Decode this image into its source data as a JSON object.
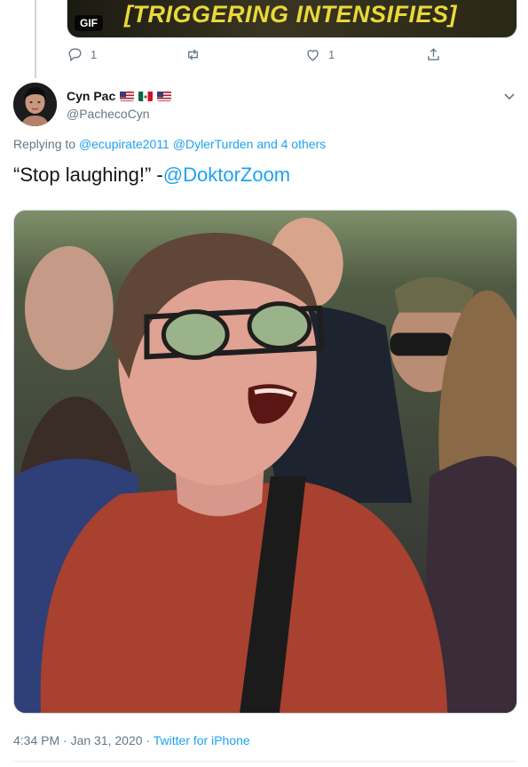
{
  "previous_tweet": {
    "gif_caption": "[TRIGGERING INTENSIFIES]",
    "gif_badge": "GIF",
    "reply_count": "1",
    "like_count": "1"
  },
  "tweet": {
    "author_name": "Cyn Pac",
    "author_handle": "@PachecoCyn",
    "flags": [
      "us-flag-icon",
      "mexico-flag-icon",
      "us-flag-icon"
    ],
    "replying_prefix": "Replying to ",
    "replying_users": [
      "@ecupirate2011",
      "@DylerTurden"
    ],
    "replying_suffix": " and 4 others",
    "text_quote": "“Stop laughing!” -",
    "text_mention": "@DoktorZoom",
    "timestamp": "4:34 PM · Jan 31, 2020",
    "separator": " · ",
    "source": "Twitter for iPhone"
  },
  "colors": {
    "link": "#1da1f2",
    "secondary_text": "#657786",
    "primary_text": "#14171a"
  }
}
